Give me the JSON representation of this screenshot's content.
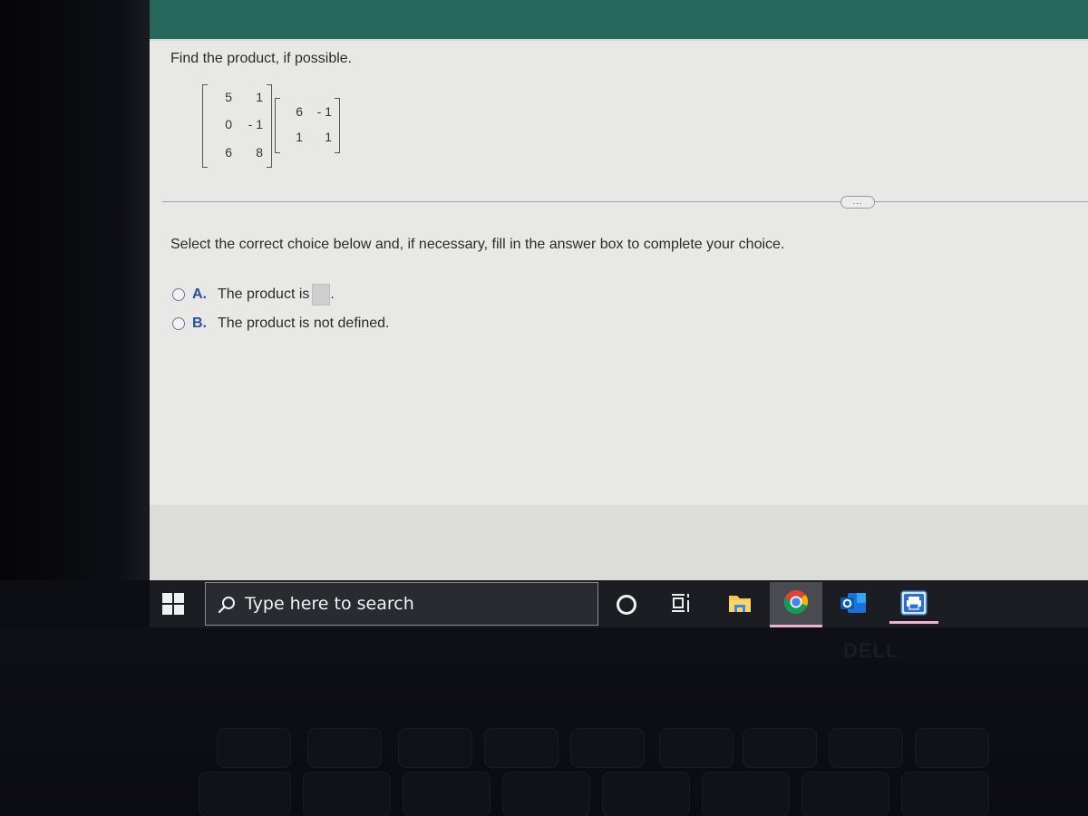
{
  "question": {
    "prompt": "Find the product, if possible.",
    "matrix_a": [
      [
        "5",
        "1"
      ],
      [
        "0",
        "- 1"
      ],
      [
        "6",
        "8"
      ]
    ],
    "matrix_b": [
      [
        "6",
        "- 1"
      ],
      [
        "1",
        "1"
      ]
    ],
    "more_button_label": "...",
    "instruction": "Select the correct choice below and, if necessary, fill in the answer box to complete your choice.",
    "choices": [
      {
        "letter": "A.",
        "text": "The product is",
        "suffix": ".",
        "has_answer_box": true,
        "answer_value": "",
        "selected": false
      },
      {
        "letter": "B.",
        "text": "The product is not defined.",
        "suffix": "",
        "has_answer_box": false,
        "selected": false
      }
    ]
  },
  "taskbar": {
    "search_placeholder": "Type here to search",
    "icons": [
      {
        "name": "cortana-icon",
        "active": false
      },
      {
        "name": "task-view-icon",
        "active": false
      },
      {
        "name": "file-explorer-icon",
        "active": false
      },
      {
        "name": "chrome-icon",
        "active": true,
        "running": true
      },
      {
        "name": "outlook-icon",
        "active": false
      },
      {
        "name": "printer-app-icon",
        "active": false,
        "running": true
      }
    ]
  },
  "laptop": {
    "brand_label": "DELL"
  },
  "colors": {
    "header": "#26685c",
    "choice_letter": "#2a4e9a",
    "running_indicator": "#f0b3cf"
  }
}
